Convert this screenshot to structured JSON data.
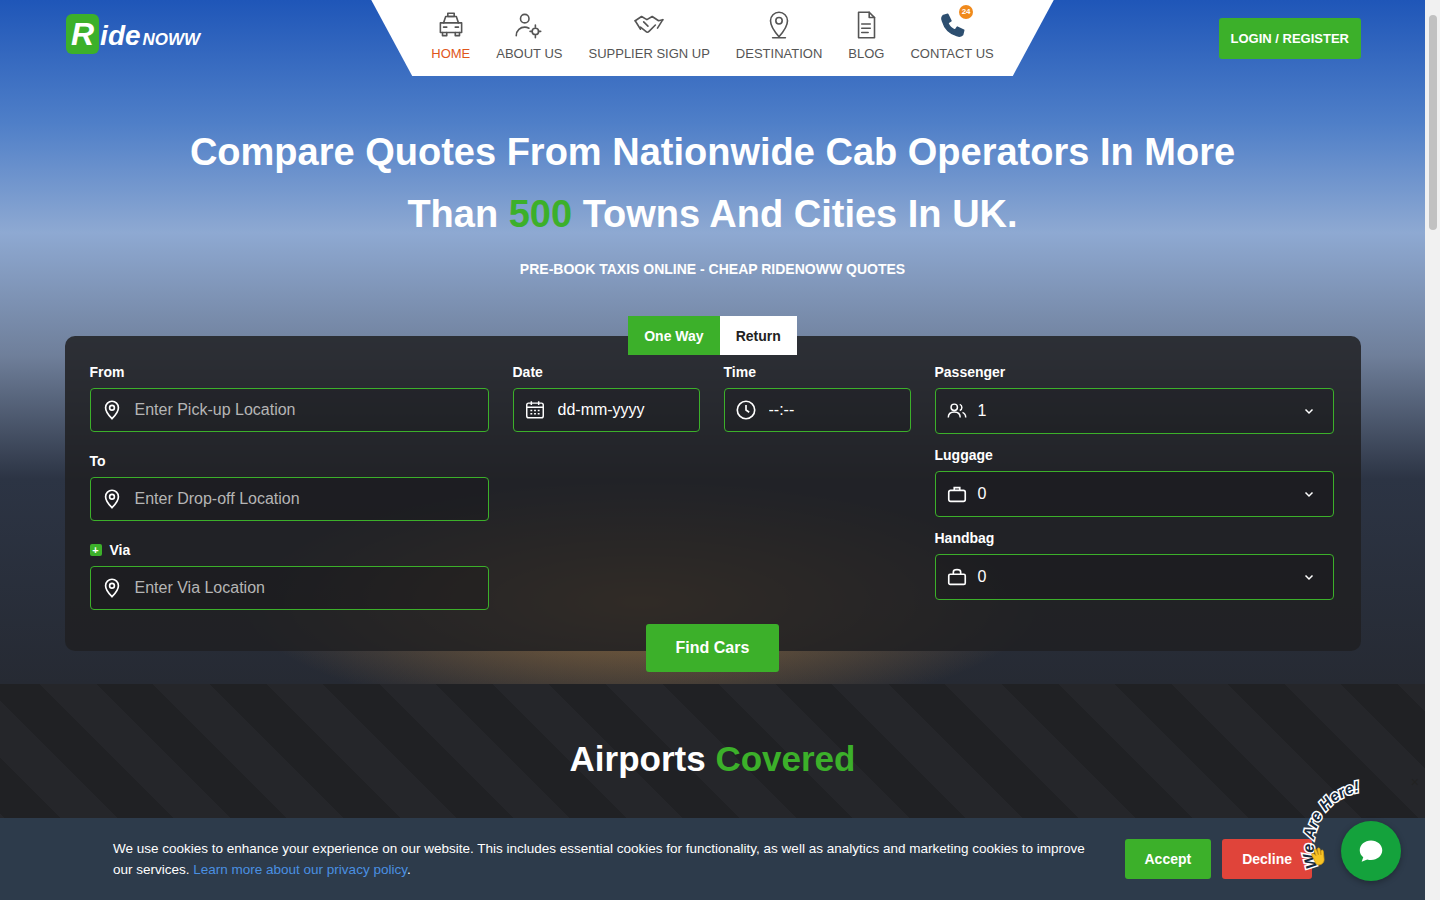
{
  "logo": {
    "mark": "R",
    "text": "ide",
    "suffix": "NOWW"
  },
  "nav": [
    {
      "label": "HOME",
      "selected": true
    },
    {
      "label": "ABOUT US",
      "selected": false
    },
    {
      "label": "SUPPLIER SIGN UP",
      "selected": false
    },
    {
      "label": "DESTINATION",
      "selected": false
    },
    {
      "label": "BLOG",
      "selected": false
    },
    {
      "label": "CONTACT US",
      "selected": false
    }
  ],
  "contact_badge": "24",
  "login_button": "LOGIN / REGISTER",
  "hero": {
    "title_before": "Compare Quotes From Nationwide Cab Operators In More Than ",
    "title_highlight": "500",
    "title_after": " Towns And Cities In UK.",
    "subtitle": "PRE-BOOK TAXIS ONLINE - CHEAP RIDENOWW QUOTES"
  },
  "trip_tabs": [
    {
      "label": "One Way",
      "selected": true
    },
    {
      "label": "Return",
      "selected": false
    }
  ],
  "form": {
    "from": {
      "label": "From",
      "placeholder": "Enter Pick-up Location"
    },
    "to": {
      "label": "To",
      "placeholder": "Enter Drop-off Location"
    },
    "via": {
      "label": "Via",
      "placeholder": "Enter Via Location",
      "add_icon": "+"
    },
    "date": {
      "label": "Date",
      "placeholder": "dd-mm-yyyy"
    },
    "time": {
      "label": "Time",
      "placeholder": "--:--"
    },
    "passenger": {
      "label": "Passenger",
      "value": "1"
    },
    "luggage": {
      "label": "Luggage",
      "value": "0"
    },
    "handbag": {
      "label": "Handbag",
      "value": "0"
    }
  },
  "find_button": "Find Cars",
  "section": {
    "title": "Airports ",
    "title_highlight": "Covered"
  },
  "cookie": {
    "text": "We use cookies to enhance your experience on our website. This includes essential cookies for functionality, as well as analytics and marketing cookies to improve our services. ",
    "link": "Learn more about our privacy policy",
    "after": ".",
    "accept": "Accept",
    "decline": "Decline"
  },
  "chat": {
    "label": "We Are Here!",
    "close": "×"
  }
}
